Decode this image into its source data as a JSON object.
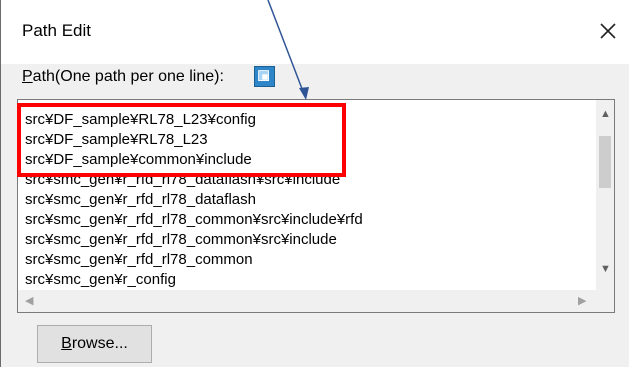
{
  "dialog": {
    "title": "Path Edit",
    "path_label_underlined": "P",
    "path_label_rest": "ath(One path per one line):",
    "browse_underlined": "B",
    "browse_rest": "rowse...",
    "lines": [
      "src¥DF_sample¥RL78_L23¥config",
      "src¥DF_sample¥RL78_L23",
      "src¥DF_sample¥common¥include",
      "src¥smc_gen¥r_rfd_rl78_dataflash¥src¥include",
      "src¥smc_gen¥r_rfd_rl78_dataflash",
      "src¥smc_gen¥r_rfd_rl78_common¥src¥include¥rfd",
      "src¥smc_gen¥r_rfd_rl78_common¥src¥include",
      "src¥smc_gen¥r_rfd_rl78_common",
      "src¥smc_gen¥r_config"
    ]
  },
  "icons": {
    "close": "close-icon",
    "insert": "insert-path-icon"
  },
  "colors": {
    "highlight": "#ff0000",
    "arrow": "#2f5597"
  }
}
